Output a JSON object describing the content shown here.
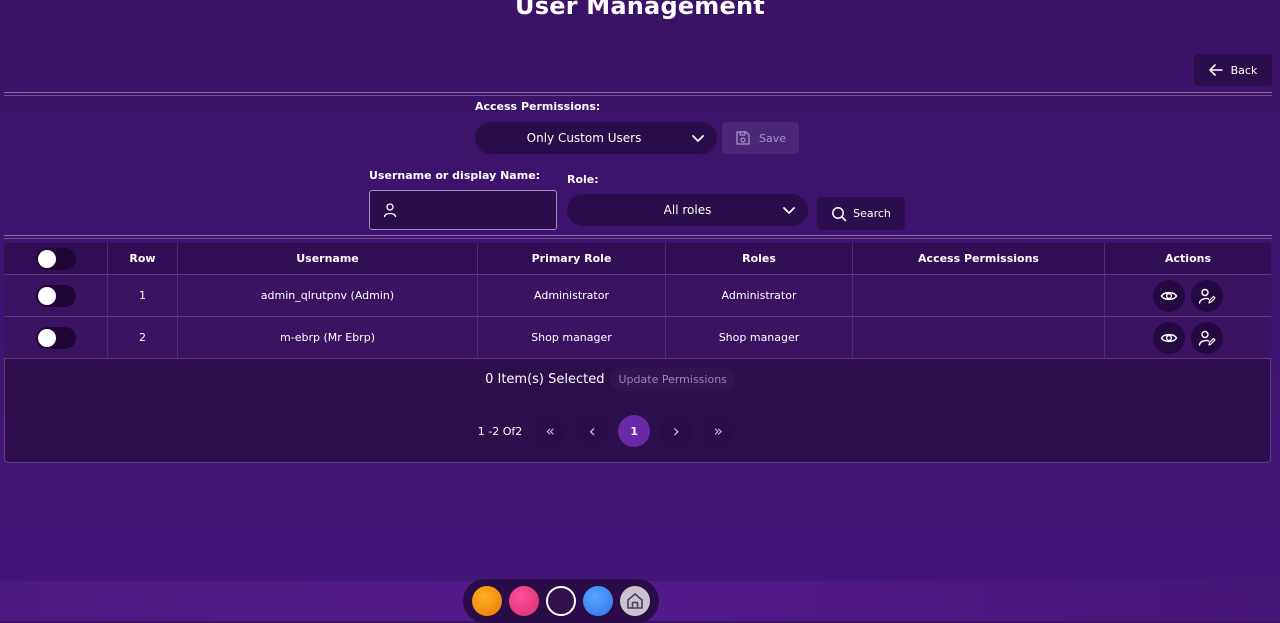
{
  "page": {
    "title": "User Management"
  },
  "header": {
    "back_label": "Back"
  },
  "filters": {
    "access_permissions_label": "Access Permissions:",
    "access_permissions_value": "Only Custom Users",
    "save_label": "Save",
    "username_label": "Username or display Name:",
    "username_value": "",
    "role_label": "Role:",
    "role_value": "All roles",
    "search_label": "Search"
  },
  "table": {
    "columns": [
      "",
      "Row",
      "Username",
      "Primary Role",
      "Roles",
      "Access Permissions",
      "Actions"
    ],
    "rows": [
      {
        "row": "1",
        "username": "admin_qlrutpnv (Admin)",
        "primary_role": "Administrator",
        "roles": "Administrator",
        "access_permissions": ""
      },
      {
        "row": "2",
        "username": "m-ebrp (Mr Ebrp)",
        "primary_role": "Shop manager",
        "roles": "Shop manager",
        "access_permissions": ""
      }
    ]
  },
  "selection": {
    "text": "0 Item(s) Selected",
    "update_label": "Update Permissions"
  },
  "pagination": {
    "info": "1 -2 Of2",
    "current_page": "1",
    "first_icon": "«",
    "prev_icon": "‹",
    "next_icon": "›",
    "last_icon": "»"
  },
  "dock": {
    "items": [
      "orange-dot",
      "pink-dot",
      "purple-dot",
      "blue-dot",
      "home-icon"
    ]
  },
  "colors": {
    "background": "#3d1470",
    "panel": "#2c0f4c",
    "accent": "#6a2aa8"
  }
}
